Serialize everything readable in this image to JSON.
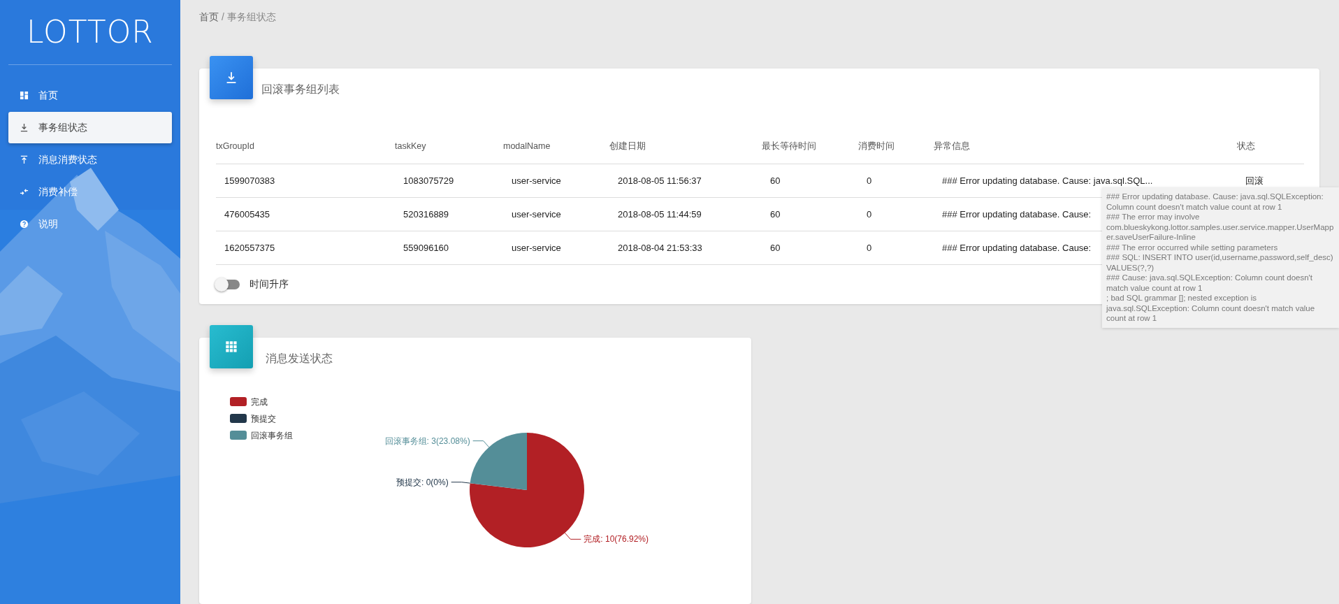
{
  "sidebar": {
    "logo": "LOTTOR",
    "items": [
      {
        "label": "首页",
        "selected": false
      },
      {
        "label": "事务组状态",
        "selected": true
      },
      {
        "label": "消息消费状态",
        "selected": false
      },
      {
        "label": "消费补偿",
        "selected": false
      },
      {
        "label": "说明",
        "selected": false
      }
    ]
  },
  "breadcrumb": [
    {
      "label": "首页",
      "kind": "link"
    },
    {
      "label": "/",
      "kind": "separator"
    },
    {
      "label": "事务组状态",
      "kind": "current"
    }
  ],
  "rollback_card": {
    "title": "回滚事务组列表",
    "table": {
      "columns": [
        "txGroupId",
        "taskKey",
        "modalName",
        "创建日期",
        "最长等待时间",
        "消费时间",
        "异常信息",
        "状态"
      ],
      "rows": [
        [
          "1599070383",
          "1083075729",
          "user-service",
          "2018-08-05 11:56:37",
          "60",
          "0",
          "### Error updating database. Cause: java.sql.SQL...",
          "回滚"
        ],
        [
          "476005435",
          "520316889",
          "user-service",
          "2018-08-05 11:44:59",
          "60",
          "0",
          "### Error updating database. Cause:"
        ],
        [
          "1620557375",
          "559096160",
          "user-service",
          "2018-08-04 21:53:33",
          "60",
          "0",
          "### Error updating database. Cause:"
        ]
      ]
    },
    "sort_toggle": {
      "label": "时间升序",
      "on": false
    }
  },
  "tooltip": {
    "text": "### Error updating database.  Cause: java.sql.SQLException: Column count doesn't match value count at row 1\n### The error may involve com.blueskykong.lottor.samples.user.service.mapper.UserMapper.saveUserFailure-Inline\n### The error occurred while setting parameters\n### SQL: INSERT INTO user(id,username,password,self_desc) VALUES(?,?)\n### Cause: java.sql.SQLException: Column count doesn't match value count at row 1\n; bad SQL grammar []; nested exception is java.sql.SQLException: Column count doesn't match value count at row 1"
  },
  "message_card": {
    "title": "消息发送状态",
    "legend": [
      {
        "label": "完成",
        "color": "#b22025"
      },
      {
        "label": "预提交",
        "color": "#22374a"
      },
      {
        "label": "回滚事务组",
        "color": "#548e98"
      }
    ],
    "chart_data": {
      "type": "pie",
      "values": [
        76.92,
        0,
        23.08
      ],
      "annotations": [
        "完成: 10(76.92%)",
        "预提交: 0(0%)",
        "回滚事务组: 3(23.08%)"
      ]
    }
  }
}
